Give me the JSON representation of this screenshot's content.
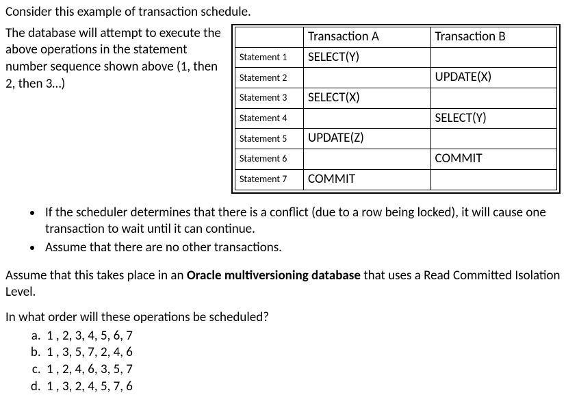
{
  "intro": "Consider this example of transaction schedule.",
  "left_paragraph": "The database will attempt to execute the above operations in the statement number sequence shown above (1, then 2, then 3…)",
  "table": {
    "headers": {
      "stmt": "",
      "a": "Transaction A",
      "b": "Transaction B"
    },
    "rows": [
      {
        "stmt": "Statement 1",
        "a": "SELECT(Y)",
        "b": ""
      },
      {
        "stmt": "Statement 2",
        "a": "",
        "b": "UPDATE(X)"
      },
      {
        "stmt": "Statement 3",
        "a": "SELECT(X)",
        "b": ""
      },
      {
        "stmt": "Statement 4",
        "a": "",
        "b": "SELECT(Y)"
      },
      {
        "stmt": "Statement 5",
        "a": "UPDATE(Z)",
        "b": ""
      },
      {
        "stmt": "Statement 6",
        "a": "",
        "b": "COMMIT"
      },
      {
        "stmt": "Statement 7",
        "a": "COMMIT",
        "b": ""
      }
    ]
  },
  "bullets": [
    "If the scheduler determines that there is a conflict (due to a row being locked), it will cause one transaction to wait until it can continue.",
    "Assume that there are no other transactions."
  ],
  "assume_pre": "Assume that this takes place in an ",
  "assume_bold": "Oracle multiversioning database",
  "assume_post": " that uses a Read Committed Isolation Level.",
  "question": "In what order will these operations be scheduled?",
  "options": [
    "1 , 2, 3, 4, 5, 6, 7",
    "1 , 3, 5, 7, 2, 4, 6",
    "1 , 2, 4, 6, 3, 5, 7",
    "1 , 3, 2, 4, 5, 7, 6"
  ]
}
